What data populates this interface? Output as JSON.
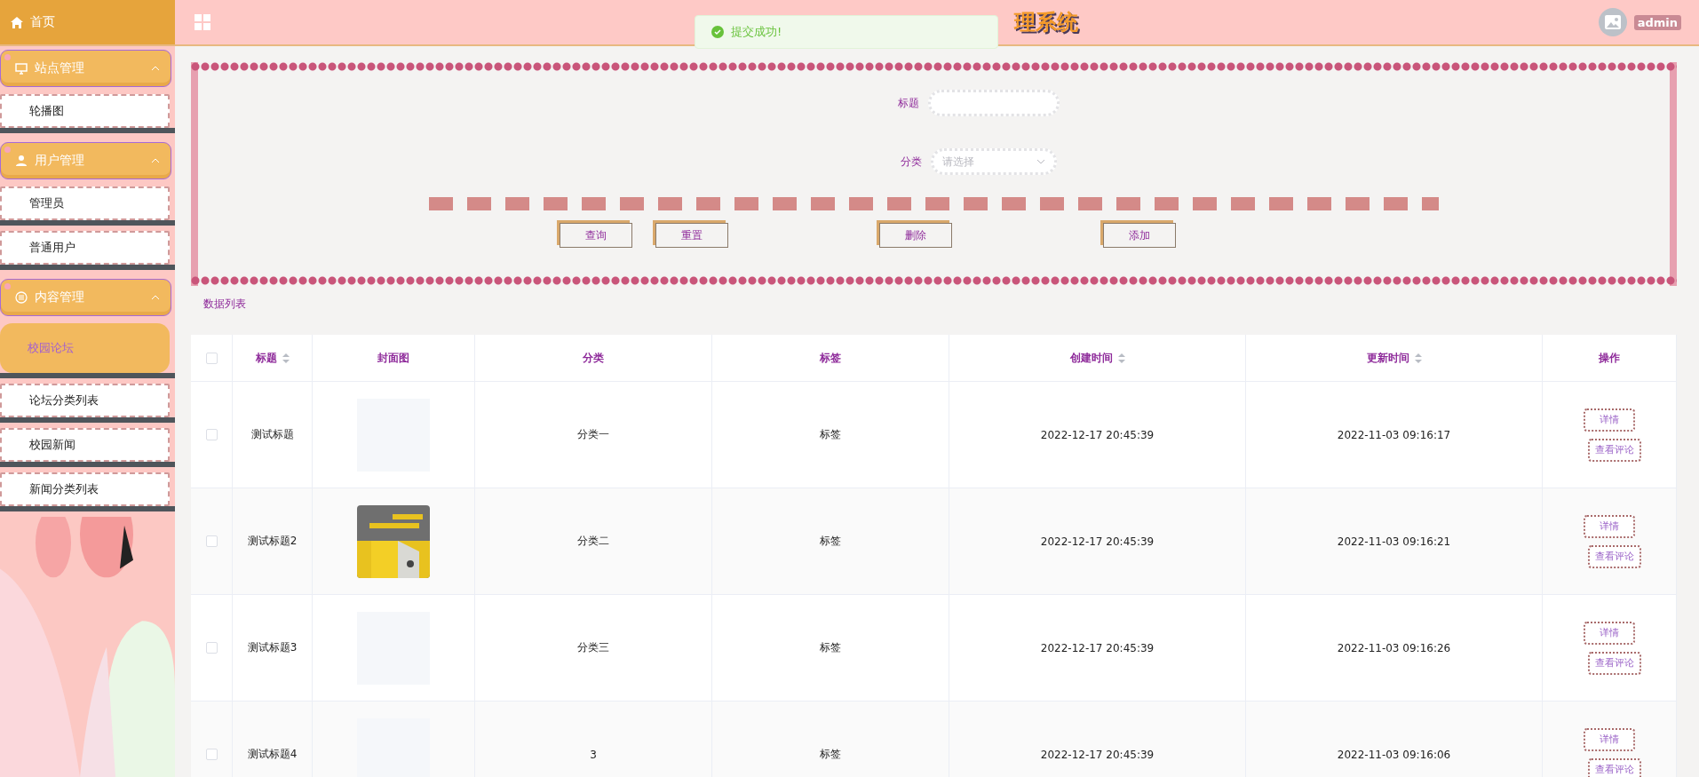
{
  "header": {
    "home": "首页",
    "title": "理系统",
    "user": "admin"
  },
  "toast": {
    "message": "提交成功!"
  },
  "sidebar": {
    "groups": [
      {
        "label": "站点管理",
        "expanded": true,
        "items": [
          {
            "label": "轮播图",
            "selected": false
          }
        ]
      },
      {
        "label": "用户管理",
        "expanded": true,
        "items": [
          {
            "label": "管理员",
            "selected": false
          },
          {
            "label": "普通用户",
            "selected": false
          }
        ]
      },
      {
        "label": "内容管理",
        "expanded": true,
        "items": [
          {
            "label": "校园论坛",
            "selected": true
          },
          {
            "label": "论坛分类列表",
            "selected": false
          },
          {
            "label": "校园新闻",
            "selected": false
          },
          {
            "label": "新闻分类列表",
            "selected": false
          }
        ]
      }
    ]
  },
  "form": {
    "fields": [
      {
        "kind": "text",
        "label": "标题"
      },
      {
        "kind": "select",
        "label": "分类",
        "placeholder": "请选择"
      }
    ],
    "buttons": [
      "查询",
      "重置",
      "删除",
      "添加"
    ]
  },
  "section_title": "数据列表",
  "table": {
    "columns": [
      {
        "kind": "checkbox",
        "checked": false
      },
      {
        "kind": "text",
        "label": "标题",
        "sortable": true
      },
      {
        "kind": "text",
        "label": "封面图",
        "sortable": false
      },
      {
        "kind": "text",
        "label": "分类",
        "sortable": false
      },
      {
        "kind": "text",
        "label": "标签",
        "sortable": false
      },
      {
        "kind": "text",
        "label": "创建时间",
        "sortable": true
      },
      {
        "kind": "text",
        "label": "更新时间",
        "sortable": true
      },
      {
        "kind": "text",
        "label": "操作",
        "sortable": false
      }
    ],
    "rows": [
      {
        "checked": false,
        "title": "测试标题",
        "cover": {
          "kind": "empty"
        },
        "category": "分类一",
        "tag": "标签",
        "created": "2022-12-17 20:45:39",
        "updated": "2022-11-03 09:16:17",
        "actions": [
          "详情",
          "查看评论"
        ]
      },
      {
        "checked": false,
        "title": "测试标题2",
        "cover": {
          "kind": "picture"
        },
        "category": "分类二",
        "tag": "标签",
        "created": "2022-12-17 20:45:39",
        "updated": "2022-11-03 09:16:21",
        "actions": [
          "详情",
          "查看评论"
        ]
      },
      {
        "checked": false,
        "title": "测试标题3",
        "cover": {
          "kind": "empty"
        },
        "category": "分类三",
        "tag": "标签",
        "created": "2022-12-17 20:45:39",
        "updated": "2022-11-03 09:16:26",
        "actions": [
          "详情",
          "查看评论"
        ]
      },
      {
        "checked": false,
        "title": "测试标题4",
        "cover": {
          "kind": "empty"
        },
        "category": "3",
        "tag": "标签",
        "created": "2022-12-17 20:45:39",
        "updated": "2022-11-03 09:16:06",
        "actions": [
          "详情",
          "查看评论"
        ]
      }
    ]
  }
}
